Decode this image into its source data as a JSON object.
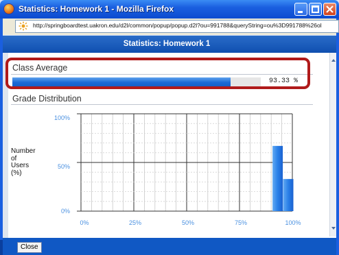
{
  "window": {
    "title": "Statistics: Homework 1 - Mozilla Firefox",
    "url": "http://springboardtest.uakron.edu/d2l/common/popup/popup.d2l?ou=991788&queryString=ou%3D991788%26ol"
  },
  "header": {
    "title": "Statistics: Homework 1"
  },
  "class_average": {
    "label": "Class Average",
    "value_text": "93.33 %",
    "value": 93.33
  },
  "grade_distribution": {
    "label": "Grade Distribution",
    "y_axis_label_lines": [
      "Number",
      "of",
      "Users",
      "(%)"
    ],
    "y_ticks": [
      "100%",
      "50%",
      "0%"
    ],
    "x_ticks": [
      "0%",
      "25%",
      "50%",
      "75%",
      "100%"
    ]
  },
  "footer": {
    "close_label": "Close"
  },
  "colors": {
    "accent": "#1c6ad6",
    "highlight": "#b01a1a",
    "header": "#0f4fb0"
  },
  "chart_data": {
    "type": "bar",
    "title": "Grade Distribution",
    "ylabel": "Number of Users (%)",
    "xlabel": "",
    "x_ticks": [
      "0%",
      "25%",
      "50%",
      "75%",
      "100%"
    ],
    "xlim": [
      0,
      100
    ],
    "ylim": [
      0,
      100
    ],
    "series": [
      {
        "values": [
          {
            "x": 95,
            "y": 67
          },
          {
            "x": 100,
            "y": 33
          }
        ]
      }
    ],
    "grid": true
  }
}
